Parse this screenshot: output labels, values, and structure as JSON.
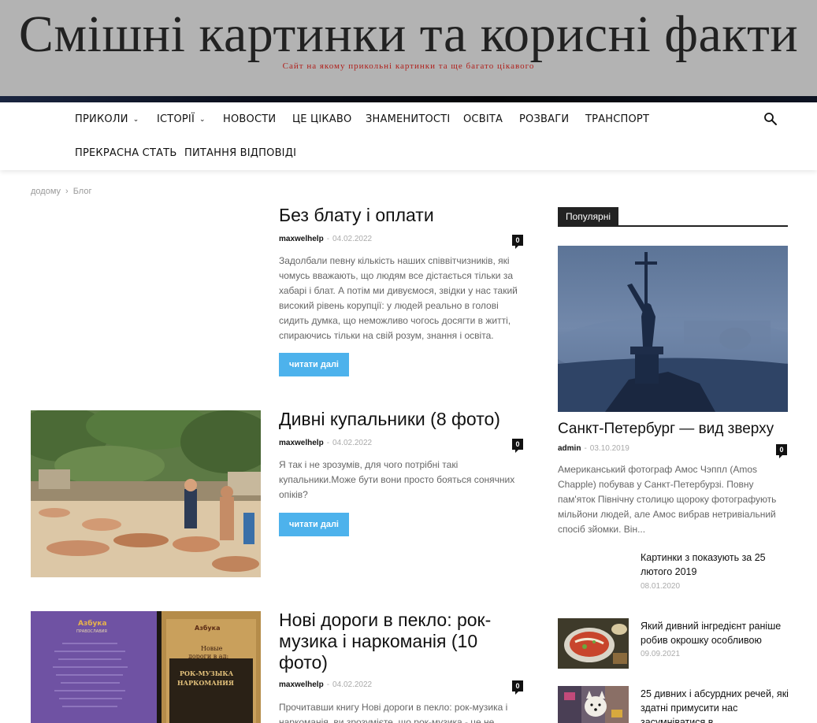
{
  "site": {
    "title": "Смішні картинки та корисні факти",
    "tagline": "Сайт на якому прикольні картинки та ще багато цікавого"
  },
  "nav": {
    "items": [
      {
        "label": "ПРИКОЛИ",
        "has_dropdown": true
      },
      {
        "label": "ІСТОРІЇ",
        "has_dropdown": true
      },
      {
        "label": "НОВОСТИ",
        "has_dropdown": false
      },
      {
        "label": "ЦЕ ЦІКАВО",
        "has_dropdown": false
      },
      {
        "label": "ЗНАМЕНИТОСТІ",
        "has_dropdown": false
      },
      {
        "label": "ОСВІТА",
        "has_dropdown": false
      },
      {
        "label": "РОЗВАГИ",
        "has_dropdown": false
      },
      {
        "label": "ТРАНСПОРТ",
        "has_dropdown": false
      },
      {
        "label": "ПРЕКРАСНА СТАТЬ",
        "has_dropdown": false
      },
      {
        "label": "ПИТАННЯ ВІДПОВІДІ",
        "has_dropdown": false
      }
    ],
    "search_icon": "search-icon"
  },
  "breadcrumb": {
    "home": "додому",
    "separator": "›",
    "current": "Блог"
  },
  "posts": [
    {
      "title": "Без блату і оплати",
      "author": "maxwelhelp",
      "dash": "-",
      "date": "04.02.2022",
      "comments": "0",
      "excerpt": "Задолбали певну кількість наших співвітчизників, які чомусь вважають, що людям все дістається тільки за хабарі і блат. А потім ми дивуємося, звідки у нас такий високий рівень корупції: у людей реально в голові сидить думка, що неможливо чогось досягти в житті, спираючись тільки на свій розум, знання і освіта.",
      "read_more": "читати далі"
    },
    {
      "title": "Дивні купальники (8 фото)",
      "author": "maxwelhelp",
      "dash": "-",
      "date": "04.02.2022",
      "comments": "0",
      "excerpt": "Я так і не зрозумів, для чого потрібні такі купальники.Може бути вони просто бояться сонячних опіків?",
      "read_more": "читати далі"
    },
    {
      "title": "Нові дороги в пекло: рок-музика і наркоманія (10 фото)",
      "author": "maxwelhelp",
      "dash": "-",
      "date": "04.02.2022",
      "comments": "0",
      "excerpt": "Прочитавши книгу Нові дороги в пекло: рок-музика і наркоманія, ви зрозумієте, що рок-музика - це не",
      "book_publisher": "Азбука",
      "book_publisher_sub": "ПРАВОСЛАВИЯ",
      "book_title_1": "Новые",
      "book_title_2": "дороги в ад:",
      "book_title_3": "РОК-МУЗЫКА",
      "book_title_4": "НАРКОМАНИЯ"
    }
  ],
  "sidebar": {
    "widget_title": "Популярні",
    "featured": {
      "title": "Санкт-Петербург — вид зверху",
      "author": "admin",
      "dash": "-",
      "date": "03.10.2019",
      "comments": "0",
      "excerpt": "Американський фотограф Амос Чэппл (Amos Chapple) побував у Санкт-Петербурзі. Повну пам'яток Північну столицю щороку фотографують мільйони людей, але Амос вибрав нетривіальний спосіб зйомки. Він..."
    },
    "items": [
      {
        "title": "Картинки з показують за 25 лютого 2019",
        "date": "08.01.2020"
      },
      {
        "title": "Який дивний інгредієнт раніше робив окрошку особливою",
        "date": "09.09.2021"
      },
      {
        "title": "25 дивних і абсурдних речей, які здатні примусити нас засумніватися в",
        "date": ""
      }
    ]
  },
  "colors": {
    "accent": "#4db2ec",
    "header_bg": "#b3b3b3",
    "tagline": "#b0201c",
    "dark": "#222222"
  }
}
